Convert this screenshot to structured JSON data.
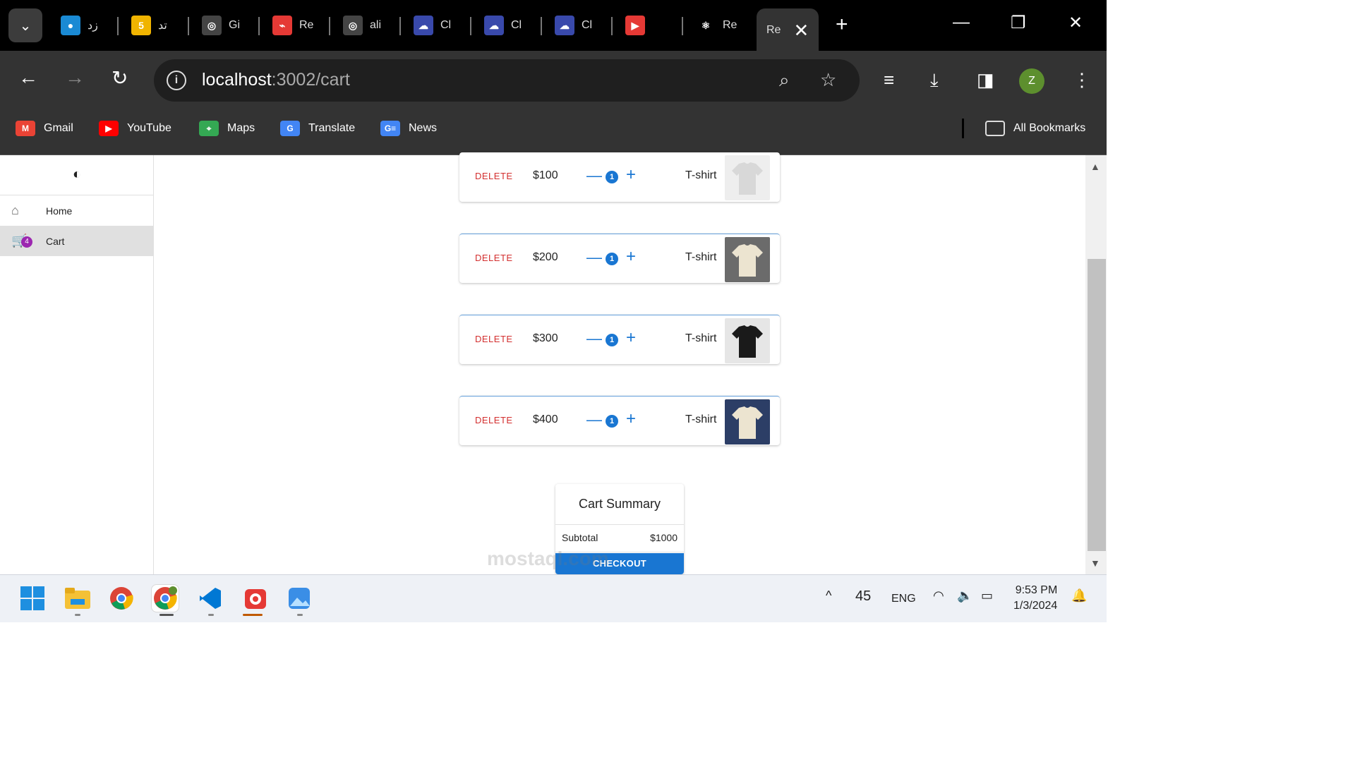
{
  "browser": {
    "tabs": [
      {
        "title": "زد",
        "color": "#1a8ad4",
        "glyph": "●"
      },
      {
        "title": "تد",
        "color": "#f0b400",
        "glyph": "5"
      },
      {
        "title": "Gi",
        "color": "#444444",
        "glyph": "◎"
      },
      {
        "title": "Re",
        "color": "#e53935",
        "glyph": "⌁"
      },
      {
        "title": "ali",
        "color": "#444444",
        "glyph": "◎"
      },
      {
        "title": "Cl",
        "color": "#3949ab",
        "glyph": "☁"
      },
      {
        "title": "Cl",
        "color": "#3949ab",
        "glyph": "☁"
      },
      {
        "title": "Cl",
        "color": "#3949ab",
        "glyph": "☁"
      },
      {
        "title": "",
        "color": "#e53935",
        "glyph": "▶"
      },
      {
        "title": "Re",
        "color": "#000000",
        "glyph": "⚛"
      }
    ],
    "active_tab": {
      "title": "Re",
      "close": "✕"
    },
    "new_tab": "+",
    "url": {
      "host": "localhost",
      "rest": ":3002/cart"
    },
    "profile_initial": "Z",
    "bookmarks": [
      {
        "label": "Gmail",
        "color": "#ea4335",
        "glyph": "M"
      },
      {
        "label": "YouTube",
        "color": "#ff0000",
        "glyph": "▶"
      },
      {
        "label": "Maps",
        "color": "#34a853",
        "glyph": "⌖"
      },
      {
        "label": "Translate",
        "color": "#4285f4",
        "glyph": "G"
      },
      {
        "label": "News",
        "color": "#4285f4",
        "glyph": "G≡"
      }
    ],
    "all_bookmarks": "All Bookmarks"
  },
  "sidebar": {
    "items": [
      {
        "label": "Home"
      },
      {
        "label": "Cart",
        "badge": "4"
      }
    ]
  },
  "cart": {
    "delete_label": "DELETE",
    "items": [
      {
        "price": "$100",
        "qty": "1",
        "name": "T-shirt",
        "shirt_color": "#d8d8d8",
        "bg": "#eeeeee"
      },
      {
        "price": "$200",
        "qty": "1",
        "name": "T-shirt",
        "shirt_color": "#ece4d0",
        "bg": "#6b6b6b"
      },
      {
        "price": "$300",
        "qty": "1",
        "name": "T-shirt",
        "shirt_color": "#1a1a1a",
        "bg": "#e6e6e6"
      },
      {
        "price": "$400",
        "qty": "1",
        "name": "T-shirt",
        "shirt_color": "#ece4d0",
        "bg": "#2c3e66"
      }
    ]
  },
  "summary": {
    "title": "Cart Summary",
    "subtotal_label": "Subtotal",
    "subtotal_value": "$1000",
    "checkout_label": "CHECKOUT"
  },
  "taskbar": {
    "temperature": "45",
    "language": "ENG",
    "time": "9:53 PM",
    "date": "1/3/2024"
  },
  "watermark": "mostaql.com",
  "colors": {
    "accent": "#1976d2",
    "danger": "#d32f2f",
    "badge": "#9c27b0"
  }
}
